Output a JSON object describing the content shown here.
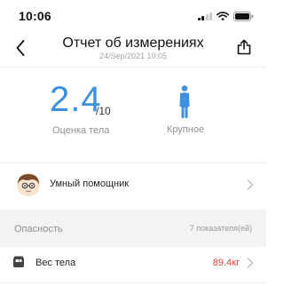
{
  "status_bar": {
    "time": "10:06"
  },
  "header": {
    "title": "Отчет об измерениях",
    "subtitle": "24/Sep/2021 10:05"
  },
  "score": {
    "value": "2.4",
    "max": "/10",
    "label": "Оценка тела"
  },
  "body_type": {
    "label": "Крупное",
    "color": "#3d8fe0"
  },
  "assistant": {
    "label": "Умный помощник"
  },
  "danger_section": {
    "title": "Опасность",
    "count": "7 показателя(ей)"
  },
  "metrics": [
    {
      "label": "Вес тела",
      "value": "89.4кг",
      "icon": "scale-icon",
      "value_color": "#e8423f"
    }
  ],
  "colors": {
    "accent": "#3d8fe0",
    "danger": "#e8423f",
    "section_bg": "#f2f3f5"
  }
}
